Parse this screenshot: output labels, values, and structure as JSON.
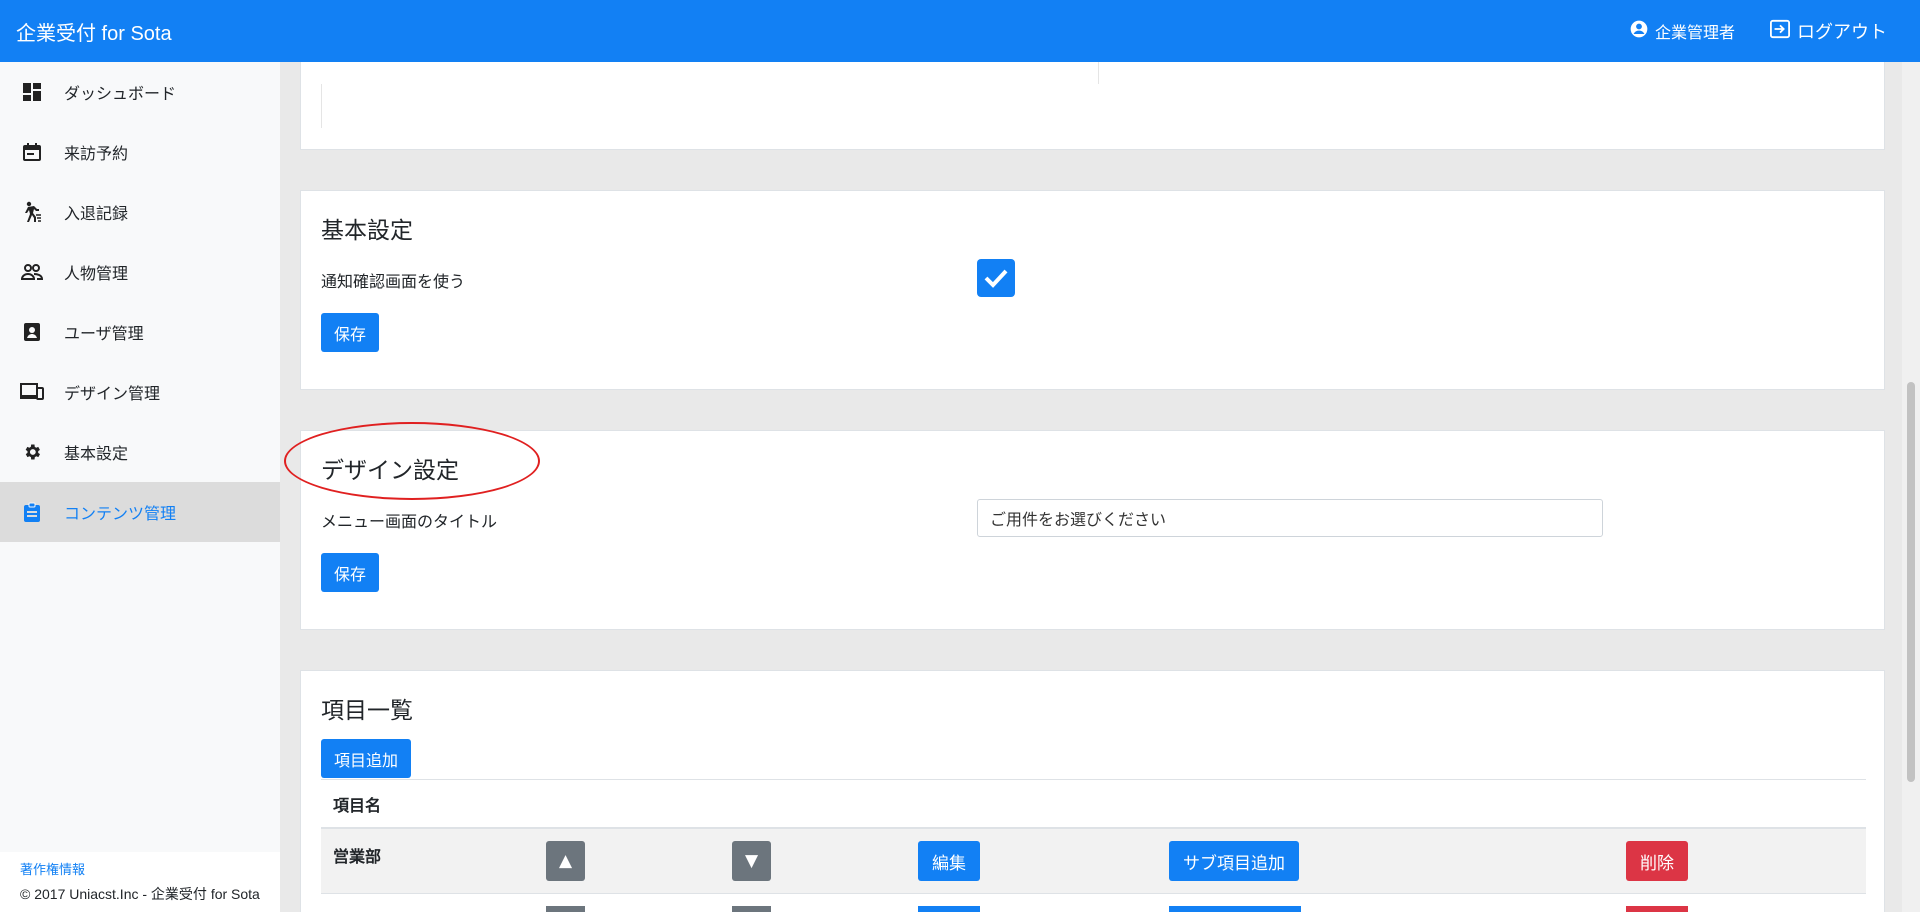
{
  "app": {
    "brand": "企業受付 for Sota"
  },
  "header": {
    "user_label": "企業管理者",
    "logout_label": "ログアウト"
  },
  "sidebar": {
    "items": [
      {
        "label": "ダッシュボード",
        "icon": "dashboard-icon"
      },
      {
        "label": "来訪予約",
        "icon": "calendar-icon"
      },
      {
        "label": "入退記録",
        "icon": "walking-icon"
      },
      {
        "label": "人物管理",
        "icon": "people-icon"
      },
      {
        "label": "ユーザ管理",
        "icon": "contact-icon"
      },
      {
        "label": "デザイン管理",
        "icon": "devices-icon"
      },
      {
        "label": "基本設定",
        "icon": "gear-icon"
      },
      {
        "label": "コンテンツ管理",
        "icon": "clipboard-icon",
        "active": true
      }
    ],
    "footer": {
      "copyright_link": "著作権情報",
      "copyright": "© 2017 Uniacst.Inc - 企業受付 for Sota"
    }
  },
  "basic_settings": {
    "title": "基本設定",
    "notify_label": "通知確認画面を使う",
    "notify_checked": true,
    "save_label": "保存"
  },
  "design_settings": {
    "title": "デザイン設定",
    "menu_title_label": "メニュー画面のタイトル",
    "menu_title_value": "ご用件をお選びください",
    "save_label": "保存"
  },
  "items_list": {
    "title": "項目一覧",
    "add_label": "項目追加",
    "column_header": "項目名",
    "rows": [
      {
        "name": "営業部",
        "up": "▲",
        "down": "▼",
        "edit": "編集",
        "add_sub": "サブ項目追加",
        "delete": "削除"
      }
    ]
  },
  "colors": {
    "accent": "#1280f4",
    "danger": "#dc3545",
    "secondary": "#6c757d",
    "annotation": "#e02020"
  }
}
